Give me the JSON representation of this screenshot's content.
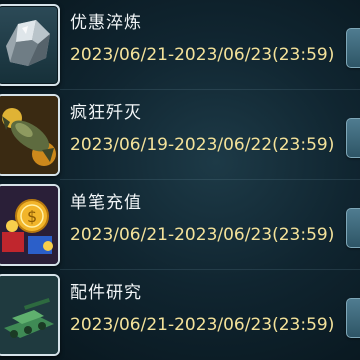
{
  "events": [
    {
      "title": "优惠淬炼",
      "period": "2023/06/21-2023/06/23(23:59)",
      "icon": "crystal-ore-icon"
    },
    {
      "title": "疯狂歼灭",
      "period": "2023/06/19-2023/06/22(23:59)",
      "icon": "missile-icon"
    },
    {
      "title": "单笔充值",
      "period": "2023/06/21-2023/06/23(23:59)",
      "icon": "gold-coin-icon"
    },
    {
      "title": "配件研究",
      "period": "2023/06/21-2023/06/23(23:59)",
      "icon": "tank-parts-icon"
    }
  ],
  "colors": {
    "title": "#f2f6f8",
    "period": "#f4e29a",
    "frame": "#d6e3ea"
  }
}
